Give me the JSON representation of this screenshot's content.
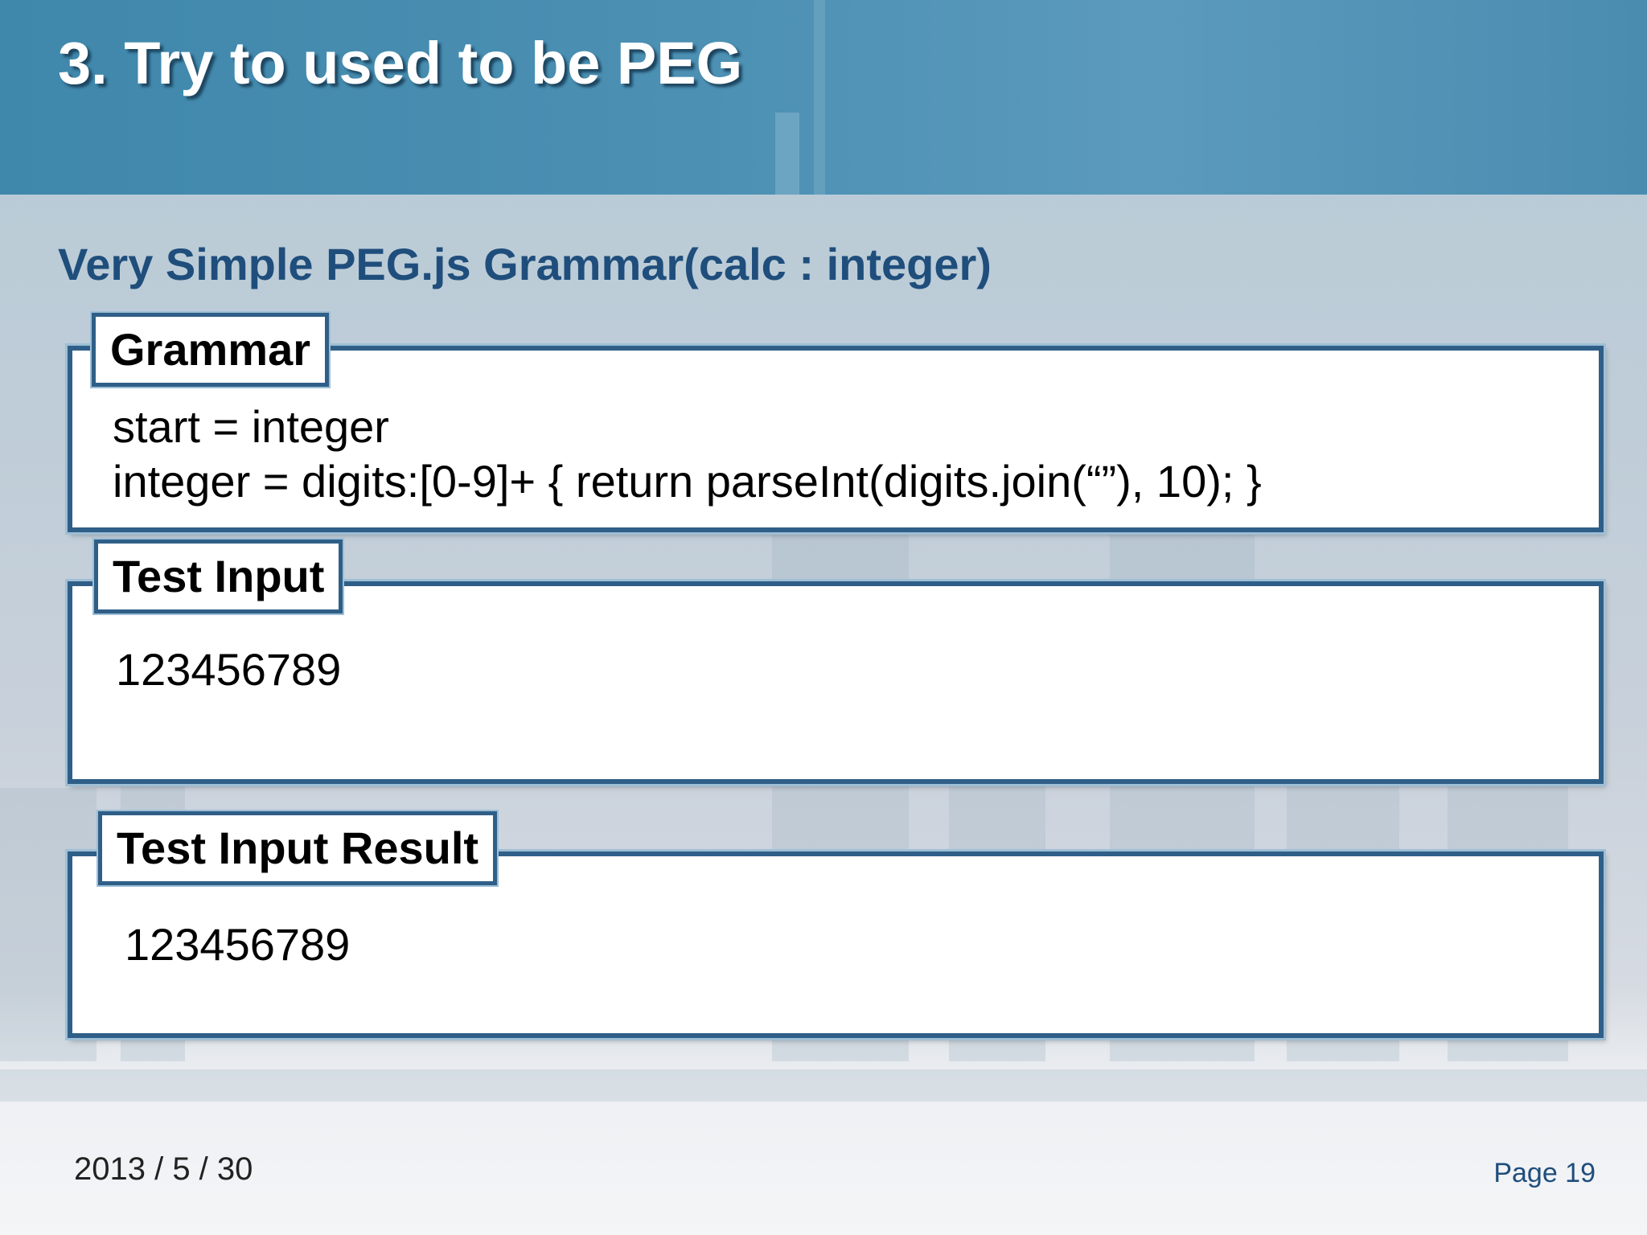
{
  "slide": {
    "title": "3. Try to used to be PEG",
    "subtitle": "Very Simple PEG.js Grammar(calc : integer)"
  },
  "grammar_panel": {
    "label": "Grammar",
    "lines": [
      "start = integer",
      "integer = digits:[0-9]+ { return parseInt(digits.join(“”), 10); }"
    ]
  },
  "input_panel": {
    "label": "Test Input",
    "value": "123456789"
  },
  "result_panel": {
    "label": "Test Input Result",
    "value": "123456789"
  },
  "footer": {
    "date": "2013 / 5 / 30",
    "page": "Page 19"
  },
  "colors": {
    "header_band": "#4a8db1",
    "subtitle": "#1f4e7c",
    "panel_border": "#2f5f88"
  }
}
